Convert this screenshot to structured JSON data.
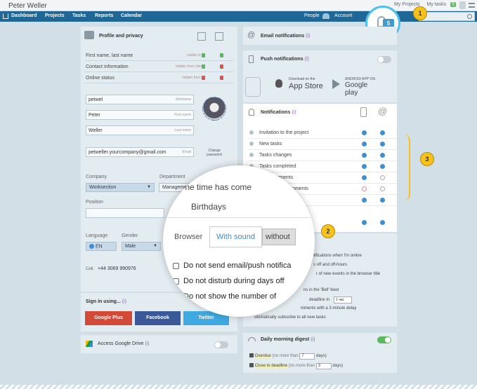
{
  "topbar": {
    "user_name": "Peter Weller",
    "my_projects": "My Projects",
    "my_tasks": "My tasks",
    "my_tasks_count": "5"
  },
  "nav": {
    "items": [
      "Dashboard",
      "Projects",
      "Tasks",
      "Reports",
      "Calendar"
    ],
    "people": "People",
    "account": "Account"
  },
  "bell": {
    "count": "5"
  },
  "callouts": {
    "one": "1",
    "two": "2",
    "three": "3"
  },
  "profile": {
    "title": "Profile and privacy",
    "privacy_rows": [
      {
        "label": "First name, last name",
        "state": "visible to all"
      },
      {
        "label": "Contact information",
        "state": "hidden from clients"
      },
      {
        "label": "Online status",
        "state": "hidden from all"
      }
    ],
    "fields": {
      "nickname": {
        "value": "petwel",
        "hint": "Nickname"
      },
      "first_name": {
        "value": "Peter",
        "hint": "First name"
      },
      "last_name": {
        "value": "Weller",
        "hint": "Last name"
      },
      "email": {
        "value": "petweller.yourcompany@gmail.com",
        "hint": "Email"
      }
    },
    "change_password": "Change password",
    "company_label": "Company",
    "company_value": "Worksection",
    "department_label": "Department",
    "department_value": "Management",
    "position_label": "Position",
    "language_label": "Language",
    "language_value": "EN",
    "gender_label": "Gender",
    "gender_value": "Male",
    "cell_label": "Cell.",
    "cell_value": "+44 3069 990976"
  },
  "signin": {
    "title": "Sign in using...",
    "info": "(i)",
    "google": "Google Plus",
    "facebook": "Facebook",
    "twitter": "Twitter"
  },
  "drive": {
    "label": "Access Google Drive",
    "info": "(i)"
  },
  "email_notifications": {
    "title": "Email notifications",
    "info": "(i)"
  },
  "push": {
    "title": "Push notifications",
    "info": "(i)",
    "appstore_top": "Download on the",
    "appstore": "App Store",
    "gplay_top": "ANDROID APP ON",
    "gplay": "Google play"
  },
  "notifications": {
    "title": "Notifications",
    "info": "(i)",
    "rows": [
      {
        "label": "Invitation to the project",
        "phone": "on",
        "email": "on"
      },
      {
        "label": "New tasks",
        "phone": "on",
        "email": "on"
      },
      {
        "label": "Tasks changes",
        "phone": "on",
        "email": "on"
      },
      {
        "label": "Tasks completed",
        "phone": "on",
        "email": "on"
      },
      {
        "label": "New comments",
        "phone": "on",
        "email": "off"
      },
      {
        "label": "Mentions in comments",
        "phone": "red",
        "email": "off"
      },
      {
        "label": "",
        "phone": "on",
        "email": "on"
      },
      {
        "label": "",
        "phone": "on",
        "email": "on"
      }
    ]
  },
  "magnifier": {
    "line1": "The time has come",
    "line2": "Birthdays",
    "tab_browser": "Browser",
    "tab_sound": "With sound",
    "tab_without": "without",
    "opt1": "Do not send email/push notifica",
    "opt2": "Do not disturb during days off",
    "opt3": "Do not show the number of"
  },
  "behind": {
    "b1": "notifications when I'm online",
    "b2": "s off and off-hours",
    "b3": "r of new events in the browser title",
    "b4": "ns in the 'Bell' feed",
    "b5": "deadline in",
    "b5_select": "1 час",
    "b6": "mments with a 3 minute delay",
    "b7": "utomatically subscribe to all new tasks"
  },
  "digest": {
    "title": "Daily morning digest",
    "info": "(i)",
    "overdue": "Overdue",
    "overdue_note": "(no more than",
    "overdue_value": "7",
    "close": "Close to deadline",
    "close_note": "(no more than",
    "close_value": "3",
    "days": "days)"
  }
}
